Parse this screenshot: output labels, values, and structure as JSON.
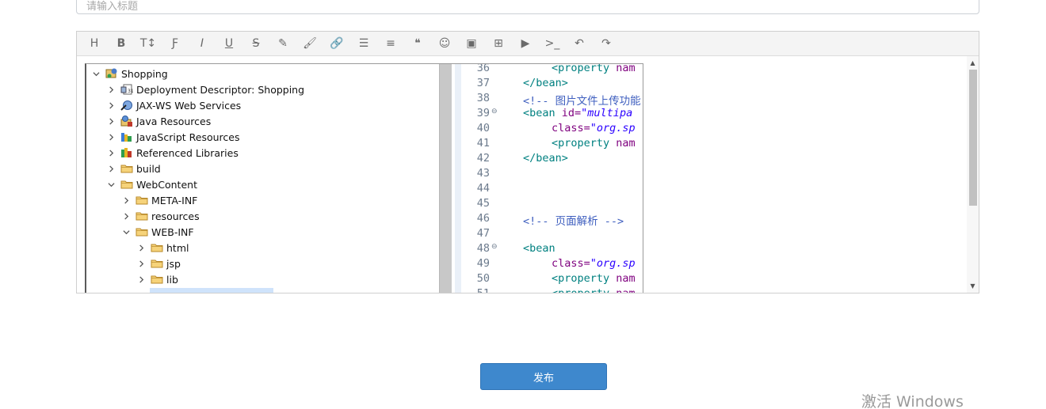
{
  "title_input": {
    "placeholder": "请输入标题",
    "value": ""
  },
  "toolbar": {
    "buttons": [
      {
        "name": "heading",
        "glyph": "H"
      },
      {
        "name": "bold",
        "glyph": "B"
      },
      {
        "name": "text-size",
        "glyph": "T↕"
      },
      {
        "name": "font",
        "glyph": "Ƒ"
      },
      {
        "name": "italic",
        "glyph": "I"
      },
      {
        "name": "underline",
        "glyph": "U"
      },
      {
        "name": "strikethrough",
        "glyph": "S"
      },
      {
        "name": "highlighter",
        "glyph": "✎"
      },
      {
        "name": "brush",
        "glyph": "🖌"
      },
      {
        "name": "link",
        "glyph": "🔗"
      },
      {
        "name": "bulleted-list",
        "glyph": "☰"
      },
      {
        "name": "align",
        "glyph": "≡"
      },
      {
        "name": "quote",
        "glyph": "❝"
      },
      {
        "name": "emoji",
        "glyph": "☺"
      },
      {
        "name": "image",
        "glyph": "▣"
      },
      {
        "name": "table",
        "glyph": "⊞"
      },
      {
        "name": "video",
        "glyph": "▶"
      },
      {
        "name": "code",
        "glyph": ">_"
      },
      {
        "name": "undo",
        "glyph": "↶"
      },
      {
        "name": "redo",
        "glyph": "↷"
      }
    ]
  },
  "project_tree": {
    "items": [
      {
        "label": "Shopping",
        "depth": 0,
        "expanded": true,
        "icon": "project-icon"
      },
      {
        "label": "Deployment Descriptor: Shopping",
        "depth": 1,
        "expanded": false,
        "icon": "descriptor-icon"
      },
      {
        "label": "JAX-WS Web Services",
        "depth": 1,
        "expanded": false,
        "icon": "webservice-icon"
      },
      {
        "label": "Java Resources",
        "depth": 1,
        "expanded": false,
        "icon": "java-resources-icon"
      },
      {
        "label": "JavaScript Resources",
        "depth": 1,
        "expanded": false,
        "icon": "js-resources-icon"
      },
      {
        "label": "Referenced Libraries",
        "depth": 1,
        "expanded": false,
        "icon": "library-icon"
      },
      {
        "label": "build",
        "depth": 1,
        "expanded": false,
        "icon": "folder-icon"
      },
      {
        "label": "WebContent",
        "depth": 1,
        "expanded": true,
        "icon": "folder-icon"
      },
      {
        "label": "META-INF",
        "depth": 2,
        "expanded": false,
        "icon": "folder-icon"
      },
      {
        "label": "resources",
        "depth": 2,
        "expanded": false,
        "icon": "folder-icon"
      },
      {
        "label": "WEB-INF",
        "depth": 2,
        "expanded": true,
        "icon": "folder-icon"
      },
      {
        "label": "html",
        "depth": 3,
        "expanded": false,
        "icon": "folder-icon"
      },
      {
        "label": "jsp",
        "depth": 3,
        "expanded": false,
        "icon": "folder-icon"
      },
      {
        "label": "lib",
        "depth": 3,
        "expanded": false,
        "icon": "folder-icon"
      }
    ]
  },
  "code_editor": {
    "lines": [
      {
        "num": "36",
        "indent": 1,
        "fold": "",
        "parts": [
          [
            "tag",
            "<property "
          ],
          [
            "attr",
            "nam"
          ]
        ]
      },
      {
        "num": "37",
        "indent": 0,
        "fold": "",
        "parts": [
          [
            "tag",
            "</bean>"
          ]
        ]
      },
      {
        "num": "38",
        "indent": 0,
        "fold": "",
        "parts": [
          [
            "cmt",
            "<!-- 图片文件上传功能,可"
          ]
        ]
      },
      {
        "num": "39",
        "indent": 0,
        "fold": "⊖",
        "parts": [
          [
            "tag",
            "<bean "
          ],
          [
            "attr",
            "id="
          ],
          [
            "val",
            "\"multipa"
          ]
        ]
      },
      {
        "num": "40",
        "indent": 1,
        "fold": "",
        "parts": [
          [
            "attr",
            "class="
          ],
          [
            "val",
            "\"org.sp"
          ]
        ]
      },
      {
        "num": "41",
        "indent": 1,
        "fold": "",
        "parts": [
          [
            "tag",
            "<property "
          ],
          [
            "attr",
            "nam"
          ]
        ]
      },
      {
        "num": "42",
        "indent": 0,
        "fold": "",
        "parts": [
          [
            "tag",
            "</bean>"
          ]
        ]
      },
      {
        "num": "43",
        "indent": 0,
        "fold": "",
        "parts": []
      },
      {
        "num": "44",
        "indent": 0,
        "fold": "",
        "parts": []
      },
      {
        "num": "45",
        "indent": 0,
        "fold": "",
        "parts": []
      },
      {
        "num": "46",
        "indent": 0,
        "fold": "",
        "parts": [
          [
            "cmt",
            "<!-- 页面解析 -->"
          ]
        ]
      },
      {
        "num": "47",
        "indent": 0,
        "fold": "",
        "parts": []
      },
      {
        "num": "48",
        "indent": 0,
        "fold": "⊖",
        "parts": [
          [
            "tag",
            "<bean"
          ]
        ]
      },
      {
        "num": "49",
        "indent": 1,
        "fold": "",
        "parts": [
          [
            "attr",
            "class="
          ],
          [
            "val",
            "\"org.sp"
          ]
        ]
      },
      {
        "num": "50",
        "indent": 1,
        "fold": "",
        "parts": [
          [
            "tag",
            "<property "
          ],
          [
            "attr",
            "nam"
          ]
        ]
      },
      {
        "num": "51",
        "indent": 1,
        "fold": "",
        "parts": [
          [
            "tag",
            "<property "
          ],
          [
            "attr",
            "nam"
          ]
        ]
      }
    ]
  },
  "publish_button": {
    "label": "发布"
  },
  "watermark": {
    "text": "激活 Windows"
  },
  "colors": {
    "accent": "#3e88cd",
    "tag": "#008080",
    "attr": "#7f007f",
    "value": "#2a00ff",
    "comment": "#3f5fbf"
  }
}
